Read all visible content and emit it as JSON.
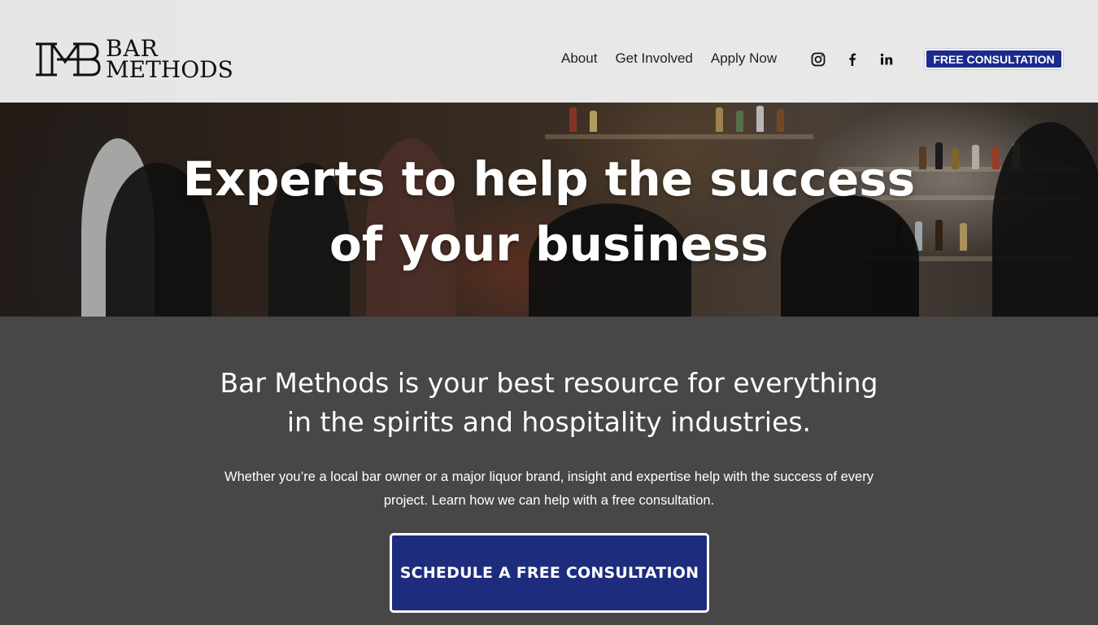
{
  "brand": {
    "name_line1": "BAR",
    "name_line2": "METHODS"
  },
  "nav": {
    "items": [
      {
        "label": "About"
      },
      {
        "label": "Get Involved"
      },
      {
        "label": "Apply Now"
      }
    ]
  },
  "socials": [
    {
      "icon": "instagram-icon"
    },
    {
      "icon": "facebook-icon"
    },
    {
      "icon": "linkedin-icon"
    }
  ],
  "header_cta": {
    "label": "FREE CONSULTATION",
    "color": "#1b2a8c"
  },
  "hero": {
    "title_line1": "Experts to help the success",
    "title_line2": "of your business"
  },
  "intro": {
    "headline_line1": "Bar Methods is your best resource for everything",
    "headline_line2": "in the spirits and hospitality industries.",
    "body_line1": "Whether you’re a local bar owner or a major liquor brand, insight and expertise help with the success of every",
    "body_line2": "project. Learn how we can help with a free consultation.",
    "cta_label": "SCHEDULE A FREE CONSULTATION",
    "cta_color": "#1e2c7e",
    "section_bg": "#474748"
  }
}
